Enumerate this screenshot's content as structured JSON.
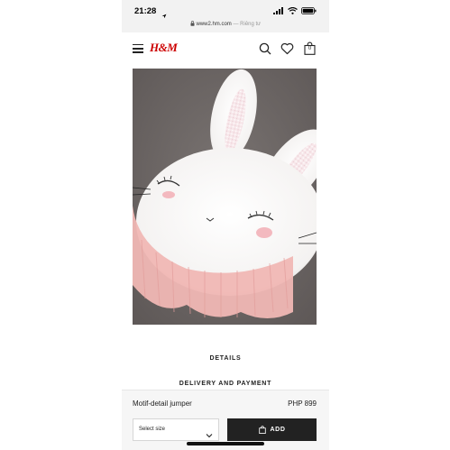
{
  "status_bar": {
    "time": "21:28",
    "location_icon": "location-arrow-icon",
    "signal_icon": "cellular-signal-icon",
    "wifi_icon": "wifi-icon",
    "battery_icon": "battery-icon"
  },
  "url_bar": {
    "host": "www2.hm.com",
    "private_label": "— Riêng tư",
    "lock_icon": "lock-icon"
  },
  "header": {
    "logo": "H&M",
    "menu_icon": "hamburger-menu-icon",
    "search_icon": "search-icon",
    "favorite_icon": "heart-icon",
    "bag_icon": "shopping-bag-icon",
    "bag_count": "0",
    "brand_color": "#cc0000"
  },
  "product": {
    "details_label": "DETAILS",
    "delivery_label": "DELIVERY AND PAYMENT",
    "name": "Motif-detail jumper",
    "price": "PHP 899",
    "size_placeholder": "Select size",
    "add_label": "ADD",
    "add_button_color": "#222222"
  }
}
